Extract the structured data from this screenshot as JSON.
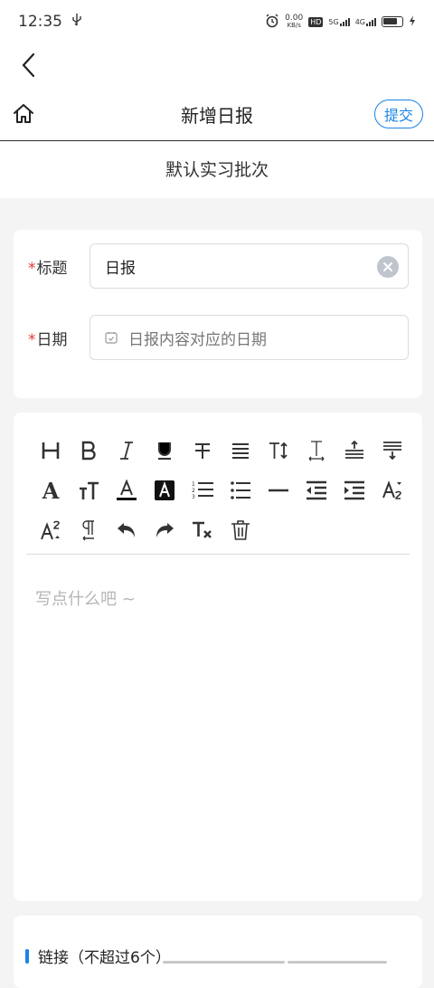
{
  "status_bar": {
    "time": "12:35",
    "net_speed_value": "0.00",
    "net_speed_unit": "KB/s",
    "hd_badge": "HD",
    "sig1": "5G",
    "sig2": "4G"
  },
  "header": {
    "title": "新增日报",
    "submit_label": "提交"
  },
  "batch": {
    "label": "默认实习批次"
  },
  "form": {
    "title_label": "标题",
    "title_value": "日报",
    "date_label": "日期",
    "date_placeholder": "日报内容对应的日期",
    "required_mark": "*"
  },
  "editor": {
    "placeholder": "写点什么吧 ~"
  },
  "links": {
    "title": "链接（不超过6个）"
  },
  "colors": {
    "accent": "#1a84e6",
    "required": "#e5372f"
  }
}
